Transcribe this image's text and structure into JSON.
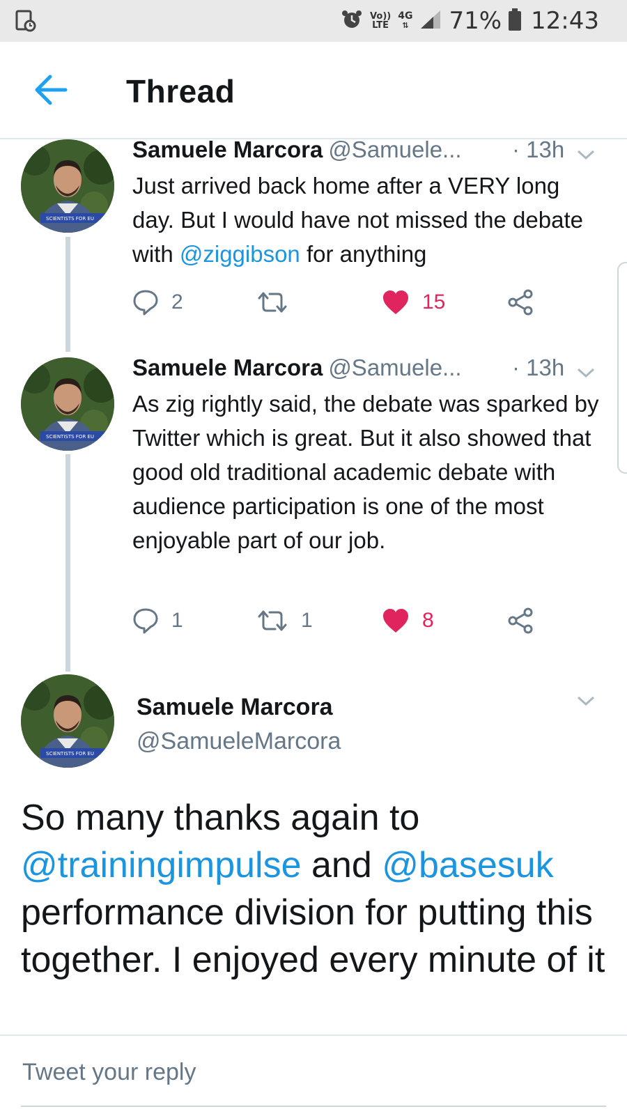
{
  "status_bar": {
    "network_top": "Vo))",
    "network_bottom": "LTE",
    "data_type": "4G",
    "battery": "71%",
    "time": "12:43"
  },
  "header": {
    "title": "Thread"
  },
  "tweets": [
    {
      "name": "Samuele Marcora",
      "handle": "@Samuele...",
      "time": "· 13h",
      "text_before": "Just arrived back home after a VERY long day. But I would have not missed the debate with ",
      "mention": "@ziggibson",
      "text_after": " for anything",
      "replies": "2",
      "retweets": "",
      "likes": "15",
      "liked": true
    },
    {
      "name": "Samuele Marcora",
      "handle": "@Samuele...",
      "time": "· 13h",
      "text": "As zig rightly said, the debate was sparked by Twitter which is great. But it also showed that good old traditional academic debate with audience participation is one of the most enjoyable part of our job.",
      "replies": "1",
      "retweets": "1",
      "likes": "8",
      "liked": true
    }
  ],
  "main_tweet": {
    "name": "Samuele Marcora",
    "handle": "@SamueleMarcora",
    "text_1": "So many thanks again to ",
    "mention_1": "@trainingimpulse",
    "text_2": " and ",
    "mention_2": "@basesuk",
    "text_3": " performance division for putting this together. I enjoyed every minute of it"
  },
  "reply": {
    "placeholder": "Tweet your reply"
  },
  "avatar": {
    "banner_text": "SCIENTISTS FOR EU"
  },
  "colors": {
    "accent": "#1da1f2",
    "like": "#e0245e",
    "muted": "#657786"
  }
}
